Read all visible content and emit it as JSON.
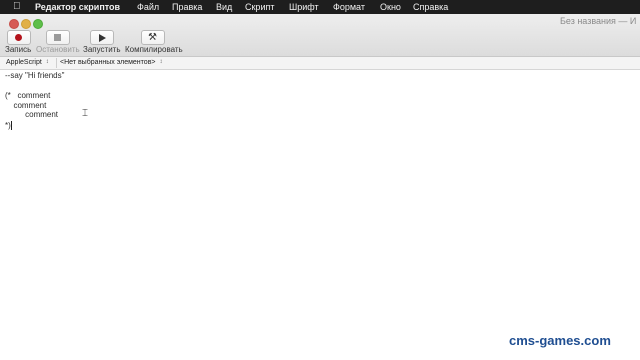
{
  "menubar": {
    "app_name": "Редактор скриптов",
    "items": [
      "Файл",
      "Правка",
      "Вид",
      "Скрипт",
      "Шрифт",
      "Формат",
      "Окно",
      "Справка"
    ]
  },
  "window": {
    "title": "Без названия — И"
  },
  "toolbar": {
    "record_label": "Запись",
    "stop_label": "Остановить",
    "run_label": "Запустить",
    "compile_label": "Компилировать"
  },
  "navbar": {
    "language": "AppleScript",
    "element_selector": "<Нет выбранных элементов>"
  },
  "editor": {
    "lines": [
      "--say \"Hi friends\"",
      "",
      "(*   comment",
      "  comment",
      "     comment",
      "*)"
    ]
  },
  "watermark": "cms-games.com",
  "colors": {
    "record": "#b3121b",
    "watermark": "#1f4e91"
  }
}
